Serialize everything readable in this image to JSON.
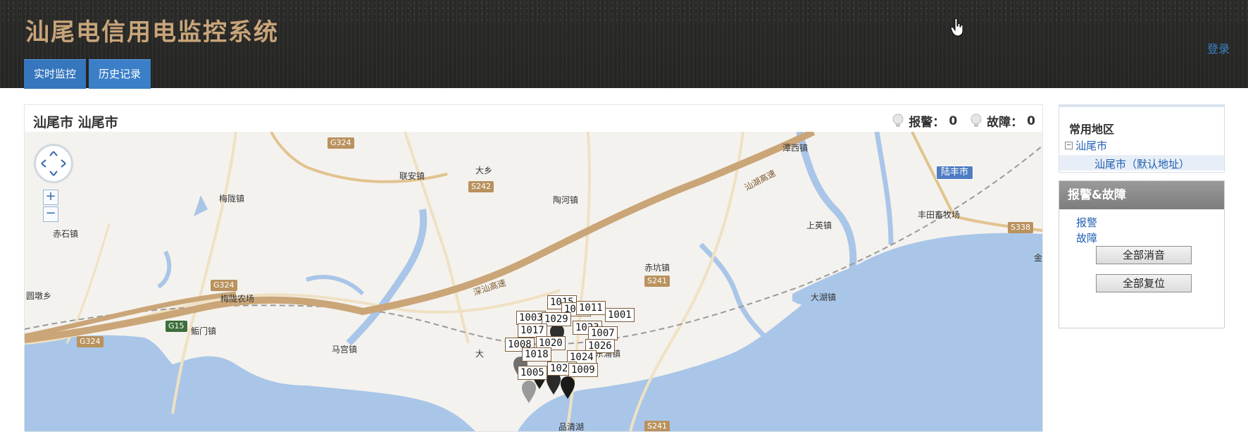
{
  "header": {
    "title": "汕尾电信用电监控系统",
    "login": "登录",
    "tabs": [
      {
        "label": "实时监控"
      },
      {
        "label": "历史记录"
      }
    ]
  },
  "panel": {
    "location": "汕尾市 汕尾市",
    "alarm_label": "报警：",
    "alarm_count": "0",
    "fault_label": "故障：",
    "fault_count": "0"
  },
  "map": {
    "places": [
      {
        "name": "联安镇"
      },
      {
        "name": "大乡"
      },
      {
        "name": "梅陇镇"
      },
      {
        "name": "陶河镇"
      },
      {
        "name": "潭西镇"
      },
      {
        "name": "赤石镇"
      },
      {
        "name": "上英镇"
      },
      {
        "name": "丰田畜牧场"
      },
      {
        "name": "赤坑镇"
      },
      {
        "name": "圆墩乡"
      },
      {
        "name": "梅陇农场"
      },
      {
        "name": "大湖镇"
      },
      {
        "name": "鲘门镇"
      },
      {
        "name": "马宫镇"
      },
      {
        "name": "东涌镇"
      },
      {
        "name": "品清湖"
      },
      {
        "name": "大"
      }
    ],
    "roads": [
      {
        "name": "G324"
      },
      {
        "name": "S242"
      },
      {
        "name": "G324"
      },
      {
        "name": "G15"
      },
      {
        "name": "G324"
      },
      {
        "name": "S241"
      },
      {
        "name": "S241"
      },
      {
        "name": "S338"
      }
    ],
    "highways": [
      {
        "name": "汕湖高速"
      },
      {
        "name": "深汕高速"
      }
    ],
    "city_label": "陆丰市",
    "edge_text": "金",
    "markers": [
      "1015",
      "1011",
      "1011",
      "1001",
      "1003",
      "1029",
      "1023",
      "1017",
      "1007",
      "1008",
      "1020",
      "1026",
      "1018",
      "1024",
      "1022",
      "1009",
      "1005"
    ]
  },
  "sidebar": {
    "common_title": "常用地区",
    "tree_root": "汕尾市",
    "tree_child": "汕尾市（默认地址）",
    "alarm_title": "报警&故障",
    "alarm_link": "报警",
    "fault_link": "故障",
    "mute_all": "全部消音",
    "reset_all": "全部复位"
  },
  "colors": {
    "header_bg": "#2b2b29",
    "title": "#c8a57a",
    "tab": "#3a7fc8",
    "link": "#1f5fb0",
    "sea": "#a9c6e8",
    "road": "#cfae7c"
  }
}
